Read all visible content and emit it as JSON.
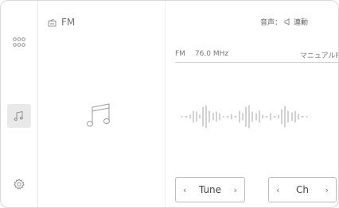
{
  "colors": {
    "icon": "#888888",
    "text": "#555555",
    "divider": "#cfcfcf",
    "active_bg": "#e9e9e9"
  },
  "sidebar": {
    "items": [
      {
        "icon": "apps-grid-icon"
      },
      {
        "icon": "music-note-icon",
        "active": true
      },
      {
        "icon": "gear-icon"
      }
    ]
  },
  "source": {
    "icon": "radio-icon",
    "label": "FM"
  },
  "header": {
    "voice_label": "音声：",
    "voice_icon": "speaker-icon",
    "voice_value": "連動"
  },
  "station": {
    "band": "FM",
    "frequency": "76.0 MHz",
    "mode": "マニュアルP"
  },
  "controls": {
    "tune": {
      "prev": "‹",
      "label": "Tune",
      "next": "›"
    },
    "channel": {
      "prev": "‹",
      "label": "Ch",
      "next": "›"
    }
  }
}
